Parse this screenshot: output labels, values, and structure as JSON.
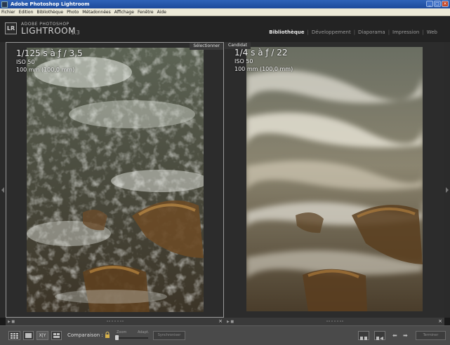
{
  "window": {
    "title": "Adobe Photoshop Lightroom",
    "buttons": [
      "_",
      "□",
      "×"
    ]
  },
  "menu": [
    "Fichier",
    "Edition",
    "Bibliothèque",
    "Photo",
    "Métadonnées",
    "Affichage",
    "Fenêtre",
    "Aide"
  ],
  "header": {
    "badge": "LR",
    "brand_small": "ADOBE PHOTOSHOP",
    "brand_big": "LIGHTROOM",
    "version": "1.3",
    "modules": [
      "Bibliothèque",
      "Développement",
      "Diaporama",
      "Impression",
      "Web"
    ],
    "active_module": "Bibliothèque"
  },
  "compare": {
    "left": {
      "label": "Sélectionner",
      "exposure": "1/125 s à ƒ / 3,5",
      "iso": "ISO 50",
      "lens": "100 mm (100,0 mm)"
    },
    "right": {
      "label": "Candidat",
      "exposure": "1/4 s à ƒ / 22",
      "iso": "ISO 50",
      "lens": "100 mm (100,0 mm)"
    }
  },
  "subbar": {
    "close": "×",
    "icons": "▶ ■"
  },
  "toolbar": {
    "view_xy": "X|Y",
    "comparison_label": "Comparaison :",
    "zoom_label": "Zoom",
    "fit_label": "Adapt.",
    "sync_label": "Synchroniser",
    "prev": "⬅",
    "next": "➡",
    "done_label": "Terminer"
  },
  "colors": {
    "accent_title": "#2f63b8",
    "background": "#2b2b2b",
    "toolbar": "#4a4a4a"
  }
}
